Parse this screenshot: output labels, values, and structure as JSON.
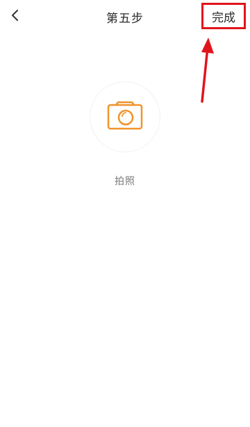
{
  "header": {
    "back_icon": "chevron-left-icon",
    "title": "第五步",
    "done_label": "完成"
  },
  "main": {
    "camera_icon": "camera-icon",
    "photo_label": "拍照"
  },
  "colors": {
    "accent": "#f0932b",
    "highlight_box": "#e0141d",
    "annotation_arrow": "#e0141d",
    "title_text": "#2b2b2b",
    "label_text": "#7a7a7a"
  }
}
